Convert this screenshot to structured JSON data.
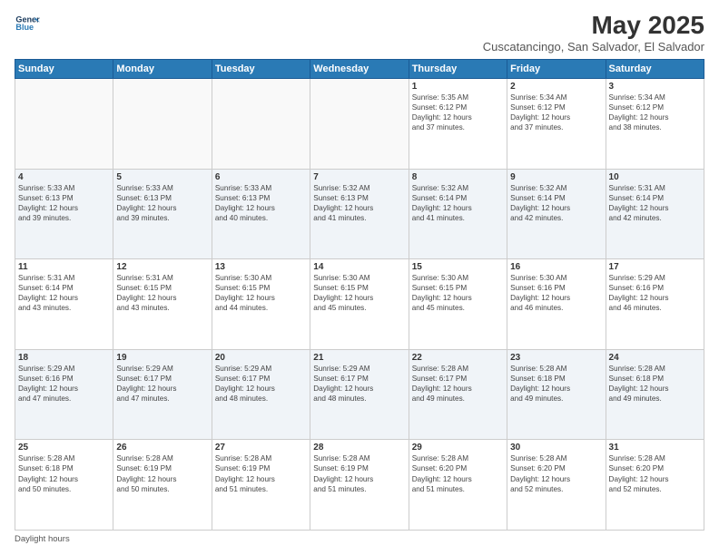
{
  "header": {
    "logo_line1": "General",
    "logo_line2": "Blue",
    "month_year": "May 2025",
    "location": "Cuscatancingo, San Salvador, El Salvador"
  },
  "days_of_week": [
    "Sunday",
    "Monday",
    "Tuesday",
    "Wednesday",
    "Thursday",
    "Friday",
    "Saturday"
  ],
  "weeks": [
    [
      {
        "date": "",
        "info": ""
      },
      {
        "date": "",
        "info": ""
      },
      {
        "date": "",
        "info": ""
      },
      {
        "date": "",
        "info": ""
      },
      {
        "date": "1",
        "info": "Sunrise: 5:35 AM\nSunset: 6:12 PM\nDaylight: 12 hours\nand 37 minutes."
      },
      {
        "date": "2",
        "info": "Sunrise: 5:34 AM\nSunset: 6:12 PM\nDaylight: 12 hours\nand 37 minutes."
      },
      {
        "date": "3",
        "info": "Sunrise: 5:34 AM\nSunset: 6:12 PM\nDaylight: 12 hours\nand 38 minutes."
      }
    ],
    [
      {
        "date": "4",
        "info": "Sunrise: 5:33 AM\nSunset: 6:13 PM\nDaylight: 12 hours\nand 39 minutes."
      },
      {
        "date": "5",
        "info": "Sunrise: 5:33 AM\nSunset: 6:13 PM\nDaylight: 12 hours\nand 39 minutes."
      },
      {
        "date": "6",
        "info": "Sunrise: 5:33 AM\nSunset: 6:13 PM\nDaylight: 12 hours\nand 40 minutes."
      },
      {
        "date": "7",
        "info": "Sunrise: 5:32 AM\nSunset: 6:13 PM\nDaylight: 12 hours\nand 41 minutes."
      },
      {
        "date": "8",
        "info": "Sunrise: 5:32 AM\nSunset: 6:14 PM\nDaylight: 12 hours\nand 41 minutes."
      },
      {
        "date": "9",
        "info": "Sunrise: 5:32 AM\nSunset: 6:14 PM\nDaylight: 12 hours\nand 42 minutes."
      },
      {
        "date": "10",
        "info": "Sunrise: 5:31 AM\nSunset: 6:14 PM\nDaylight: 12 hours\nand 42 minutes."
      }
    ],
    [
      {
        "date": "11",
        "info": "Sunrise: 5:31 AM\nSunset: 6:14 PM\nDaylight: 12 hours\nand 43 minutes."
      },
      {
        "date": "12",
        "info": "Sunrise: 5:31 AM\nSunset: 6:15 PM\nDaylight: 12 hours\nand 43 minutes."
      },
      {
        "date": "13",
        "info": "Sunrise: 5:30 AM\nSunset: 6:15 PM\nDaylight: 12 hours\nand 44 minutes."
      },
      {
        "date": "14",
        "info": "Sunrise: 5:30 AM\nSunset: 6:15 PM\nDaylight: 12 hours\nand 45 minutes."
      },
      {
        "date": "15",
        "info": "Sunrise: 5:30 AM\nSunset: 6:15 PM\nDaylight: 12 hours\nand 45 minutes."
      },
      {
        "date": "16",
        "info": "Sunrise: 5:30 AM\nSunset: 6:16 PM\nDaylight: 12 hours\nand 46 minutes."
      },
      {
        "date": "17",
        "info": "Sunrise: 5:29 AM\nSunset: 6:16 PM\nDaylight: 12 hours\nand 46 minutes."
      }
    ],
    [
      {
        "date": "18",
        "info": "Sunrise: 5:29 AM\nSunset: 6:16 PM\nDaylight: 12 hours\nand 47 minutes."
      },
      {
        "date": "19",
        "info": "Sunrise: 5:29 AM\nSunset: 6:17 PM\nDaylight: 12 hours\nand 47 minutes."
      },
      {
        "date": "20",
        "info": "Sunrise: 5:29 AM\nSunset: 6:17 PM\nDaylight: 12 hours\nand 48 minutes."
      },
      {
        "date": "21",
        "info": "Sunrise: 5:29 AM\nSunset: 6:17 PM\nDaylight: 12 hours\nand 48 minutes."
      },
      {
        "date": "22",
        "info": "Sunrise: 5:28 AM\nSunset: 6:17 PM\nDaylight: 12 hours\nand 49 minutes."
      },
      {
        "date": "23",
        "info": "Sunrise: 5:28 AM\nSunset: 6:18 PM\nDaylight: 12 hours\nand 49 minutes."
      },
      {
        "date": "24",
        "info": "Sunrise: 5:28 AM\nSunset: 6:18 PM\nDaylight: 12 hours\nand 49 minutes."
      }
    ],
    [
      {
        "date": "25",
        "info": "Sunrise: 5:28 AM\nSunset: 6:18 PM\nDaylight: 12 hours\nand 50 minutes."
      },
      {
        "date": "26",
        "info": "Sunrise: 5:28 AM\nSunset: 6:19 PM\nDaylight: 12 hours\nand 50 minutes."
      },
      {
        "date": "27",
        "info": "Sunrise: 5:28 AM\nSunset: 6:19 PM\nDaylight: 12 hours\nand 51 minutes."
      },
      {
        "date": "28",
        "info": "Sunrise: 5:28 AM\nSunset: 6:19 PM\nDaylight: 12 hours\nand 51 minutes."
      },
      {
        "date": "29",
        "info": "Sunrise: 5:28 AM\nSunset: 6:20 PM\nDaylight: 12 hours\nand 51 minutes."
      },
      {
        "date": "30",
        "info": "Sunrise: 5:28 AM\nSunset: 6:20 PM\nDaylight: 12 hours\nand 52 minutes."
      },
      {
        "date": "31",
        "info": "Sunrise: 5:28 AM\nSunset: 6:20 PM\nDaylight: 12 hours\nand 52 minutes."
      }
    ]
  ],
  "footer": {
    "note": "Daylight hours"
  }
}
